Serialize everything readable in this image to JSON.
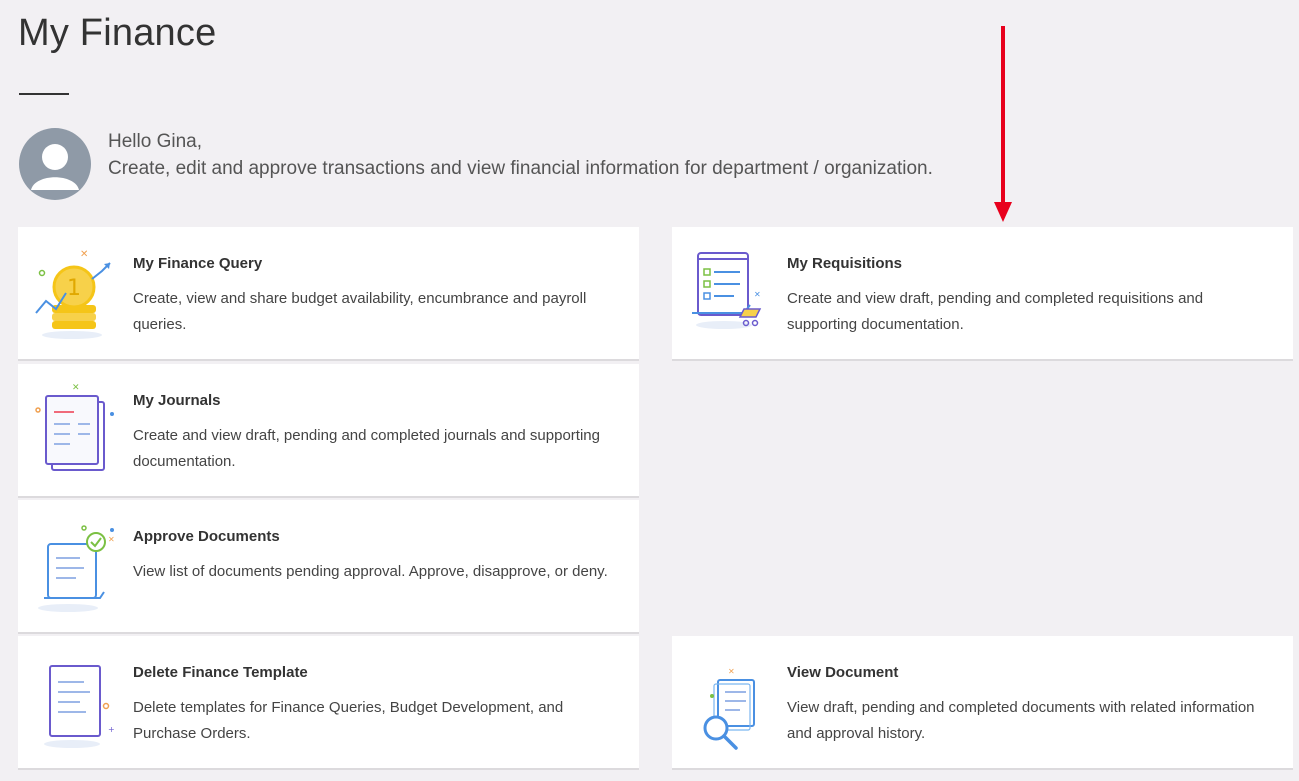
{
  "page": {
    "title": "My Finance"
  },
  "welcome": {
    "greeting": "Hello Gina,",
    "description": "Create, edit and approve transactions and view financial information for department / organization."
  },
  "tiles": [
    {
      "title": "My Finance Query",
      "description": "Create, view and share budget availability, encumbrance and payroll queries.",
      "icon": "finance-query-coin-icon"
    },
    {
      "title": "My Requisitions",
      "description": "Create and view draft, pending and completed requisitions and supporting documentation.",
      "icon": "requisitions-cart-icon"
    },
    {
      "title": "My Journals",
      "description": "Create and view draft, pending and completed journals and supporting documentation.",
      "icon": "journals-book-icon"
    },
    {
      "title": "Approve Documents",
      "description": "View list of documents pending approval. Approve, disapprove, or deny.",
      "icon": "approve-document-check-icon"
    },
    {
      "title": "Delete Finance Template",
      "description": "Delete templates for Finance Queries, Budget Development, and Purchase Orders.",
      "icon": "delete-template-document-icon"
    },
    {
      "title": "View Document",
      "description": "View draft, pending and completed documents with related information and approval history.",
      "icon": "view-document-magnifier-icon"
    }
  ],
  "annotation": {
    "icon": "red-arrow-down-icon",
    "color": "#e8001c"
  },
  "colors": {
    "background": "#f2f0f3",
    "card": "#ffffff",
    "icon_blue": "#4a90e2",
    "icon_purple": "#6a5acd",
    "coin_gold": "#f5c518"
  }
}
